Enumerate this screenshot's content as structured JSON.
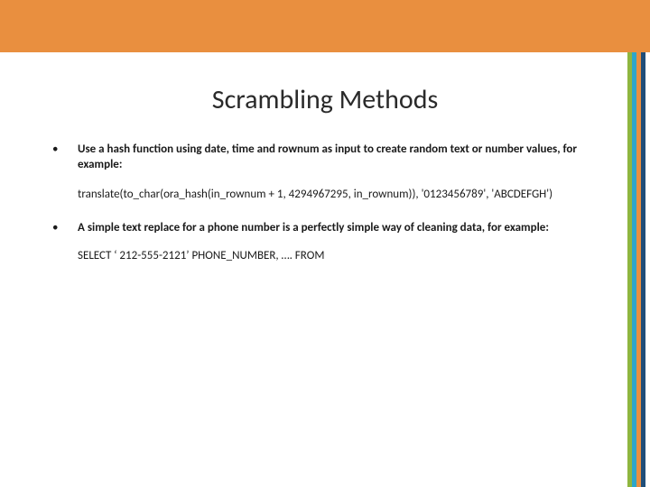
{
  "title": "Scrambling Methods",
  "bullets": [
    {
      "text": "Use a hash function using date, time and rownum as input to create random text or number values, for example:",
      "example": "translate(to_char(ora_hash(in_rownum + 1, 4294967295, in_rownum)), '0123456789', 'ABCDEFGH')"
    },
    {
      "text": "A simple text replace for a phone number is a perfectly simple way of cleaning data, for example:",
      "example": "SELECT ‘ 212-555-2121’ PHONE_NUMBER, …. FROM"
    }
  ]
}
